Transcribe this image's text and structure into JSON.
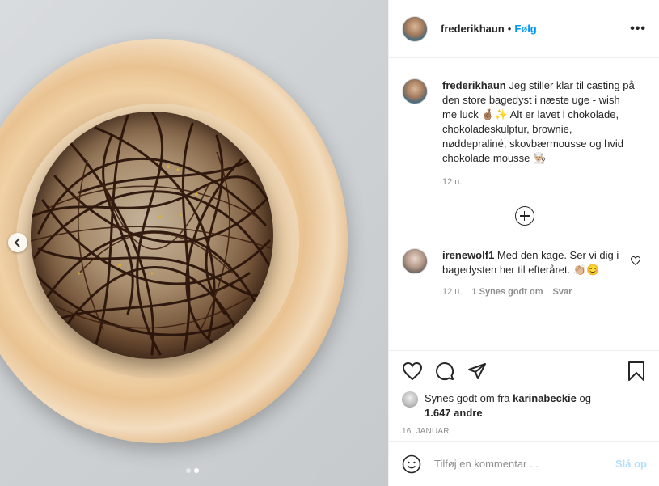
{
  "post": {
    "username": "frederikhaun",
    "separator": "•",
    "follow_label": "Følg",
    "more_label": "•••",
    "caption": "Jeg stiller klar til casting på den store bagedyst i næste uge - wish me luck 🤞🏽✨ Alt er lavet i chokolade, chokoladeskulptur, brownie, nøddepraliné, skovbærmousse og hvid chokolade mousse 👨🏼‍🍳",
    "caption_time": "12 u.",
    "icons": {
      "nav_prev": "chevron-left-icon",
      "load_more": "plus-circle-icon",
      "like": "heart-icon",
      "comment": "comment-icon",
      "share": "paper-plane-icon",
      "save": "bookmark-icon",
      "emoji": "smiley-icon"
    }
  },
  "comment": {
    "username": "irenewolf1",
    "text": "Med den kage. Ser vi dig i bagedysten her til efteråret. 👏🏼😊",
    "time": "12 u.",
    "likes": "1 Synes godt om",
    "reply": "Svar"
  },
  "likes": {
    "prefix": "Synes godt om fra ",
    "user": "karinabeckie",
    "mid": " og",
    "count": "1.647 andre"
  },
  "date": "16. JANUAR",
  "add_comment": {
    "placeholder": "Tilføj en kommentar ...",
    "post_label": "Slå op"
  },
  "carousel": {
    "current": 2,
    "total": 2
  }
}
